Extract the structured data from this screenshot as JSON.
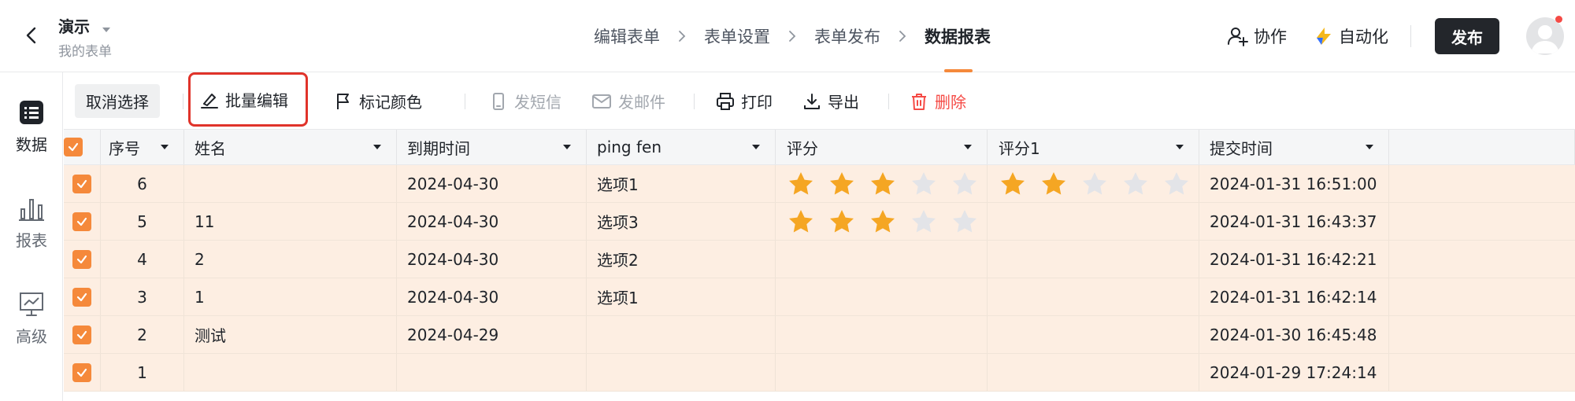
{
  "header": {
    "title": "演示",
    "subtitle": "我的表单",
    "steps": [
      "编辑表单",
      "表单设置",
      "表单发布",
      "数据报表"
    ],
    "active_step": 3,
    "collab_label": "协作",
    "automation_label": "自动化",
    "publish_label": "发布"
  },
  "sidebar": {
    "items": [
      {
        "label": "数据",
        "icon": "list-icon",
        "active": true
      },
      {
        "label": "报表",
        "icon": "bar-chart-icon",
        "active": false
      },
      {
        "label": "高级",
        "icon": "presentation-chart-icon",
        "active": false
      }
    ]
  },
  "toolbar": {
    "cancel_selection": "取消选择",
    "batch_edit": "批量编辑",
    "mark_color": "标记颜色",
    "send_sms": "发短信",
    "send_email": "发邮件",
    "print": "打印",
    "export": "导出",
    "delete": "删除"
  },
  "table": {
    "columns": [
      "序号",
      "姓名",
      "到期时间",
      "ping fen",
      "评分",
      "评分1",
      "提交时间"
    ],
    "rows": [
      {
        "seq": "6",
        "name": "",
        "due": "2024-04-30",
        "ping": "选项1",
        "score": 3,
        "score1": 2,
        "submit": "2024-01-31 16:51:00"
      },
      {
        "seq": "5",
        "name": "11",
        "due": "2024-04-30",
        "ping": "选项3",
        "score": 3,
        "score1": null,
        "submit": "2024-01-31 16:43:37"
      },
      {
        "seq": "4",
        "name": "2",
        "due": "2024-04-30",
        "ping": "选项2",
        "score": null,
        "score1": null,
        "submit": "2024-01-31 16:42:21"
      },
      {
        "seq": "3",
        "name": "1",
        "due": "2024-04-30",
        "ping": "选项1",
        "score": null,
        "score1": null,
        "submit": "2024-01-31 16:42:14"
      },
      {
        "seq": "2",
        "name": "测试",
        "due": "2024-04-29",
        "ping": "",
        "score": null,
        "score1": null,
        "submit": "2024-01-30 16:45:48"
      },
      {
        "seq": "1",
        "name": "",
        "due": "",
        "ping": "",
        "score": null,
        "score1": null,
        "submit": "2024-01-29 17:24:14"
      }
    ],
    "star_max": 5
  },
  "colors": {
    "accent": "#f5893b",
    "row_selected_bg": "#fdeee2",
    "star_on": "#f5a623",
    "star_off": "#e3e4e8",
    "danger": "#f54a45",
    "highlight_box": "#e0332a"
  }
}
